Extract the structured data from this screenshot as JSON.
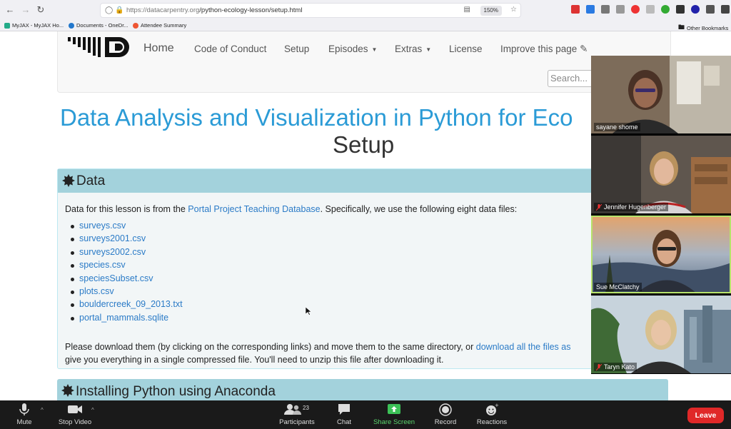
{
  "browser": {
    "url_prefix": "https://datacarpentry.org",
    "url_path": "/python-ecology-lesson/setup.html",
    "zoom": "150%",
    "bookmarks": [
      "MyJAX - MyJAX Ho...",
      "Documents - OneDr...",
      "Attendee Summary"
    ],
    "other_bookmarks": "Other Bookmarks"
  },
  "site": {
    "nav": {
      "home": "Home",
      "code_of_conduct": "Code of Conduct",
      "setup": "Setup",
      "episodes": "Episodes",
      "extras": "Extras",
      "license": "License",
      "improve": "Improve this page"
    },
    "search_placeholder": "Search...",
    "title": "Data Analysis and Visualization in Python for Eco",
    "subtitle": "Setup"
  },
  "data_panel": {
    "heading": "Data",
    "intro_before": "Data for this lesson is from the ",
    "intro_link": "Portal Project Teaching Database",
    "intro_after": ". Specifically, we use the following eight data files:",
    "files": [
      "surveys.csv",
      "surveys2001.csv",
      "surveys2002.csv",
      "species.csv",
      "speciesSubset.csv",
      "plots.csv",
      "bouldercreek_09_2013.txt",
      "portal_mammals.sqlite"
    ],
    "foot_line1_before": "Please download them (by clicking on the corresponding links) and move them to the same directory, or ",
    "foot_line1_link": "download all the files as",
    "foot_line2": "give you everything in a single compressed file. You'll need to unzip this file after downloading it."
  },
  "panel2": {
    "heading": "Installing Python using Anaconda"
  },
  "participants": [
    {
      "name": "sayane shome",
      "muted": false,
      "speaking": false,
      "bg": "#8a7a68"
    },
    {
      "name": "Jennifer Hugenberger",
      "muted": true,
      "speaking": false,
      "bg": "#6d6257"
    },
    {
      "name": "Sue McClatchy",
      "muted": false,
      "speaking": true,
      "bg": "#7f8a9a"
    },
    {
      "name": "Taryn Kato",
      "muted": true,
      "speaking": false,
      "bg": "#5f7d8a"
    }
  ],
  "zoom_toolbar": {
    "mute": "Mute",
    "stop_video": "Stop Video",
    "participants": "Participants",
    "participants_count": "23",
    "chat": "Chat",
    "share_screen": "Share Screen",
    "record": "Record",
    "reactions": "Reactions",
    "leave": "Leave"
  }
}
